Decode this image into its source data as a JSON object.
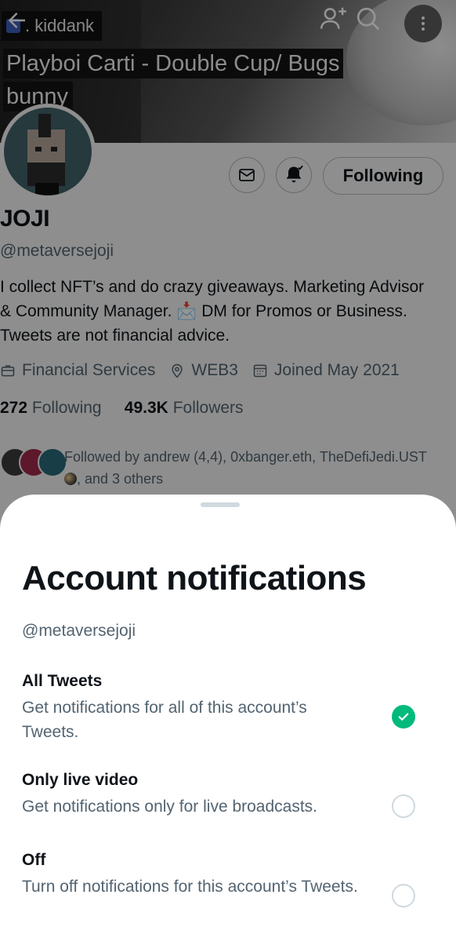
{
  "header": {
    "username_chip": ". kiddank",
    "song_line_1": "Playboi Carti - Double Cup/ Bugs",
    "song_line_2": "bunny"
  },
  "profile": {
    "display_name": "JOJI",
    "handle": "@metaversejoji",
    "bio": "I collect NFT’s and do crazy giveaways. Marketing Advisor & Community Manager. 📩 DM for Promos or Business. Tweets are not financial advice.",
    "category": "Financial Services",
    "location": "WEB3",
    "joined": "Joined May 2021",
    "following_count": "272",
    "following_label": "Following",
    "followers_count": "49.3K",
    "followers_label": "Followers",
    "followed_by_prefix": "Followed by andrew (4,4), 0xbanger.eth, TheDefiJedi.UST",
    "followed_by_suffix": ", and 3 others",
    "following_button": "Following"
  },
  "sheet": {
    "title": "Account notifications",
    "handle": "@metaversejoji",
    "options": [
      {
        "title": "All Tweets",
        "description": "Get notifications for all of this account’s Tweets.",
        "selected": true
      },
      {
        "title": "Only live video",
        "description": "Get notifications only for live broadcasts.",
        "selected": false
      },
      {
        "title": "Off",
        "description": "Turn off notifications for this account’s Tweets.",
        "selected": false
      }
    ]
  },
  "colors": {
    "accent_green": "#00ba7c",
    "secondary_text": "#536471",
    "primary_text": "#0f1419"
  },
  "icons": [
    "back-arrow-icon",
    "add-user-icon",
    "search-icon",
    "more-icon",
    "mail-icon",
    "bell-icon",
    "briefcase-icon",
    "location-icon",
    "calendar-icon",
    "checkmark-icon"
  ]
}
